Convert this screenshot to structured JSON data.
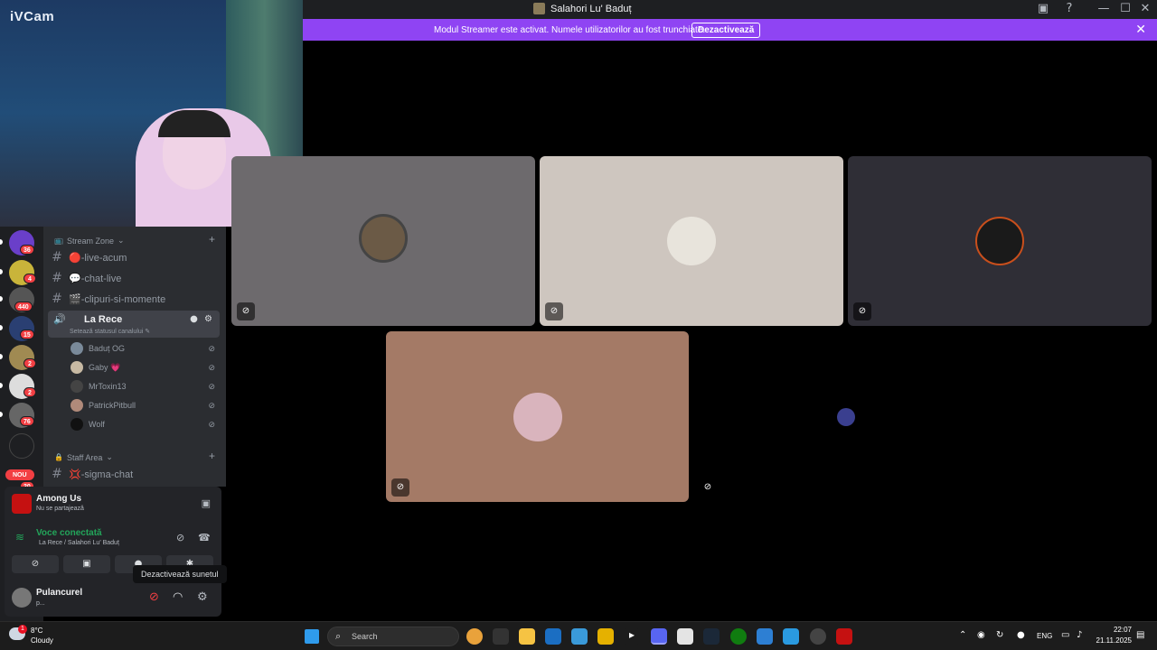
{
  "window": {
    "title": "Salahori Lu' Baduț",
    "controls": {
      "minimize": "—",
      "maximize": "☐",
      "close": "✕"
    }
  },
  "banner": {
    "text": "Modul Streamer este activat. Numele utilizatorilor au fost trunchiate.",
    "button": "Dezactivează",
    "close": "✕",
    "color": "#8f44f3"
  },
  "webcam": {
    "label": "iVCam"
  },
  "servers": {
    "badges": [
      "36",
      "4",
      "440",
      "15",
      "2",
      "2",
      "76"
    ],
    "new_badge": "NOU",
    "last_badge": "20"
  },
  "channels": {
    "category_1": "Stream Zone",
    "items": [
      {
        "name": "🔴-live-acum"
      },
      {
        "name": "💬-chat-live"
      },
      {
        "name": "🎬-clipuri-si-momente"
      }
    ],
    "voice_channel": {
      "name": "La Rece",
      "status": "Setează statusul canalului ✎"
    },
    "members": [
      {
        "name": "Baduț OG"
      },
      {
        "name": "Gaby 💗"
      },
      {
        "name": "MrToxin13"
      },
      {
        "name": "PatrickPitbull"
      },
      {
        "name": "Wolf"
      }
    ],
    "category_2": "Staff Area",
    "staff_items": [
      {
        "name": "💢-sigma-chat"
      }
    ]
  },
  "activity": {
    "title": "Among Us",
    "subtitle": "Nu se partajează"
  },
  "voice": {
    "status": "Voce conectată",
    "channel": "La Rece / Salahori Lu' Baduț"
  },
  "user": {
    "name": "Pulancurel",
    "status": "p..."
  },
  "tooltip": "Dezactivează sunetul",
  "taskbar": {
    "weather_temp": "8°C",
    "weather_condition": "Cloudy",
    "weather_badge": "1",
    "search_placeholder": "Search",
    "lang": "ENG",
    "time": "22:07",
    "date": "21.11.2025"
  }
}
